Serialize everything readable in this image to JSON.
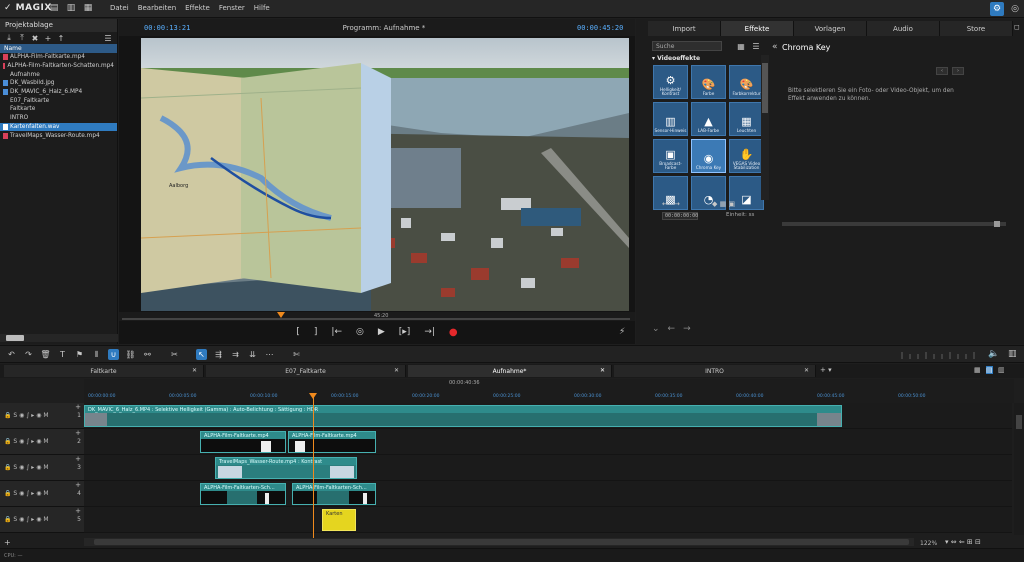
{
  "app": {
    "logo": "✓ MAGIX"
  },
  "menu": {
    "items": [
      "Datei",
      "Bearbeiten",
      "Effekte",
      "Fenster",
      "Hilfe"
    ]
  },
  "project": {
    "header": "Projektablage",
    "column": "Name",
    "items": [
      {
        "label": "ALPHA-Film-Faltkarte.mp4",
        "type": "file-red"
      },
      {
        "label": "ALPHA-Film-Faltkarten-Schatten.mp4",
        "type": "file-red"
      },
      {
        "label": "Aufnahme",
        "type": "folder"
      },
      {
        "label": "DK_Wasbild.jpg",
        "type": "file-blue"
      },
      {
        "label": "DK_MAVIC_6_Halz_6.MP4",
        "type": "file-blue"
      },
      {
        "label": "E07_Faltkarte",
        "type": "folder"
      },
      {
        "label": "Faltkarte",
        "type": "folder"
      },
      {
        "label": "INTRO",
        "type": "folder"
      },
      {
        "label": "Kartenfalten.wav",
        "type": "file-sel"
      },
      {
        "label": "TravelMaps_Wasser-Route.mp4",
        "type": "file-red"
      }
    ]
  },
  "preview": {
    "tc_current": "00:00:13:21",
    "title": "Programm: Aufnahme *",
    "tc_total": "00:00:45:20",
    "mini_label": "45:20",
    "map_place": "Aalborg"
  },
  "effects": {
    "tabs": [
      "Import",
      "Effekte",
      "Vorlagen",
      "Audio",
      "Store"
    ],
    "active_tab": "Effekte",
    "search_placeholder": "Suche",
    "category": "Videoeffekte",
    "tiles": [
      {
        "label": "Helligkeit/ Kontrast",
        "icon": "⚙"
      },
      {
        "label": "Farbe",
        "icon": "🎨"
      },
      {
        "label": "Farbkorrektur",
        "icon": "🎨"
      },
      {
        "label": "Sensor-Hinweis",
        "icon": "▥"
      },
      {
        "label": "LAB-Farbe",
        "icon": "▲"
      },
      {
        "label": "Leuchten",
        "icon": "▦"
      },
      {
        "label": "Broadcast-Farbe",
        "icon": "▣"
      },
      {
        "label": "Chroma Key",
        "icon": "◉",
        "selected": true
      },
      {
        "label": "VEGAS Video Stabilization",
        "icon": "✋"
      },
      {
        "label": "",
        "icon": "▩"
      },
      {
        "label": "",
        "icon": "◔"
      },
      {
        "label": "",
        "icon": "◪"
      }
    ],
    "detail_title": "Chroma Key",
    "detail_desc": "Bitte selektieren Sie ein Foto- oder Video-Objekt, um den Effekt anwenden zu können.",
    "detail_btns": [
      "‹",
      "›"
    ],
    "timecode": "00:00:00:00",
    "unit": "Einheit: ss"
  },
  "timeline": {
    "tabs": [
      "Faltkarte",
      "E07_Faltkarte",
      "Aufnahme*",
      "INTRO"
    ],
    "active_tab": "Aufnahme*",
    "center_tc": "00:00:40:36",
    "ticks": [
      "00:00:00:00",
      "00:00:05:00",
      "00:00:10:00",
      "00:00:15:00",
      "00:00:20:00",
      "00:00:25:00",
      "00:00:30:00",
      "00:00:35:00",
      "00:00:40:00",
      "00:00:45:00",
      "00:00:50:00"
    ],
    "clips": {
      "t1": "DK_MAVIC_6_Halz_6.MP4 : Selektive Helligkeit (Gamma) : Auto-Belichtung : Sättigung : HDR",
      "t2a": "ALPHA-Film-Faltkarte.mp4",
      "t2b": "ALPHA-Film-Faltkarte.mp4",
      "t3a": "TravelMaps_Wasser-Route.mp4 : Kontrast",
      "t4a": "ALPHA-Film-Faltkarten-Sch...",
      "t4b": "ALPHA-Film-Faltkarten-Sch...",
      "t5": "Karten"
    },
    "track_numbers": [
      "1",
      "2",
      "3",
      "4",
      "5"
    ],
    "zoom": "122%",
    "cpu": "CPU: —"
  }
}
